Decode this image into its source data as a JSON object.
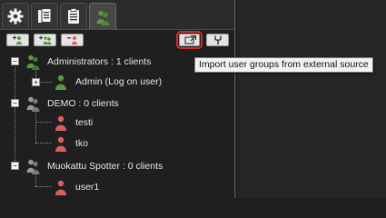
{
  "tabs": [
    {
      "icon": "gear-icon",
      "active": false
    },
    {
      "icon": "documents-icon",
      "active": false
    },
    {
      "icon": "clipboard-icon",
      "active": false
    },
    {
      "icon": "users-icon",
      "active": true
    }
  ],
  "toolbar": {
    "buttons": [
      {
        "icon": "add-user-icon"
      },
      {
        "icon": "add-group-icon"
      },
      {
        "icon": "remove-user-icon"
      },
      {
        "icon": "import-groups-icon",
        "highlighted": true
      },
      {
        "icon": "filter-icon"
      }
    ],
    "tooltip": "Import user groups from external source"
  },
  "tree": {
    "groups": [
      {
        "label": "Administrators : 1 clients",
        "icon_color": "#5a9a3c",
        "children": [
          {
            "label": "Admin (Log on user)",
            "icon_color": "#5a9a3c",
            "expandable": true
          }
        ]
      },
      {
        "label": "DEMO : 0 clients",
        "icon_color": "#8a8a8a",
        "children": [
          {
            "label": "testi",
            "icon_color": "#d9615a"
          },
          {
            "label": "tko",
            "icon_color": "#d9615a"
          }
        ]
      },
      {
        "label": "Muokattu Spotter : 0 clients",
        "icon_color": "#8a8a8a",
        "children": [
          {
            "label": "user1",
            "icon_color": "#d9615a"
          }
        ]
      }
    ]
  },
  "colors": {
    "highlight_outline": "#d62828",
    "online_user": "#5a9a3c",
    "offline_user": "#d9615a",
    "group_inactive": "#8a8a8a"
  }
}
